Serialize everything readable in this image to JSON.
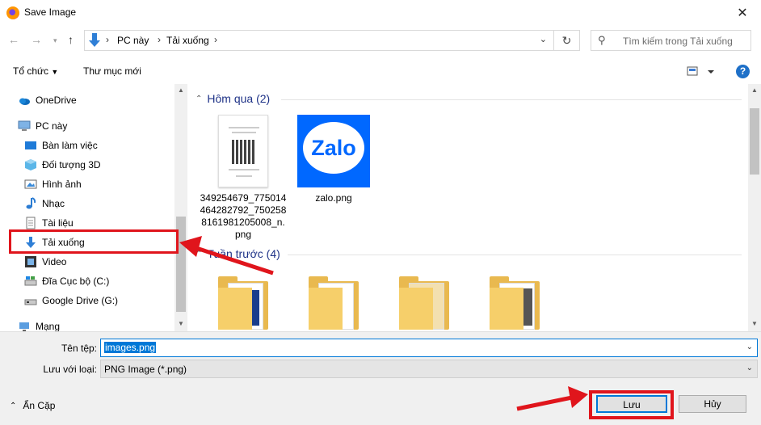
{
  "window": {
    "title": "Save Image",
    "close_icon": "close-icon"
  },
  "nav": {
    "breadcrumbs": [
      "PC này",
      "Tải xuống"
    ],
    "search_placeholder": "Tìm kiếm trong Tải xuống"
  },
  "toolbar": {
    "organize": "Tổ chức",
    "new_folder": "Thư mục mới",
    "help": "?"
  },
  "sidebar": {
    "items": [
      {
        "label": "OneDrive",
        "icon": "cloud-icon"
      },
      {
        "label": "PC này",
        "icon": "computer-icon"
      },
      {
        "label": "Bàn làm việc",
        "icon": "desktop-icon"
      },
      {
        "label": "Đối tượng 3D",
        "icon": "cube-icon"
      },
      {
        "label": "Hình ảnh",
        "icon": "pictures-icon"
      },
      {
        "label": "Nhạc",
        "icon": "music-icon"
      },
      {
        "label": "Tài liệu",
        "icon": "documents-icon"
      },
      {
        "label": "Tải xuống",
        "icon": "download-icon",
        "selected": true
      },
      {
        "label": "Video",
        "icon": "video-icon"
      },
      {
        "label": "Đĩa Cục bộ (C:)",
        "icon": "drive-icon"
      },
      {
        "label": "Google Drive (G:)",
        "icon": "drive-icon"
      },
      {
        "label": "Mạng",
        "icon": "network-icon"
      }
    ]
  },
  "files": {
    "groups": [
      {
        "header": "Hôm qua (2)",
        "items": [
          {
            "name": "349254679_775014464282792_7502588161981205008_n.png",
            "thumb": "qr-document"
          },
          {
            "name": "zalo.png",
            "thumb": "zalo-logo",
            "logo_text": "Zalo"
          }
        ]
      },
      {
        "header": "Tuần trước (4)",
        "items": [
          {
            "name": "",
            "thumb": "folder"
          },
          {
            "name": "",
            "thumb": "folder"
          },
          {
            "name": "",
            "thumb": "folder"
          },
          {
            "name": "",
            "thumb": "folder"
          }
        ]
      }
    ]
  },
  "form": {
    "filename_label": "Tên tệp:",
    "filename_value": "images.png",
    "filetype_label": "Lưu với loại:",
    "filetype_value": "PNG Image (*.png)",
    "hide_folders": "Ẩn Cặp",
    "save_button": "Lưu",
    "cancel_button": "Hủy"
  },
  "colors": {
    "accent": "#0078d7",
    "annotation": "#e0151c",
    "group_header": "#1e3287"
  }
}
